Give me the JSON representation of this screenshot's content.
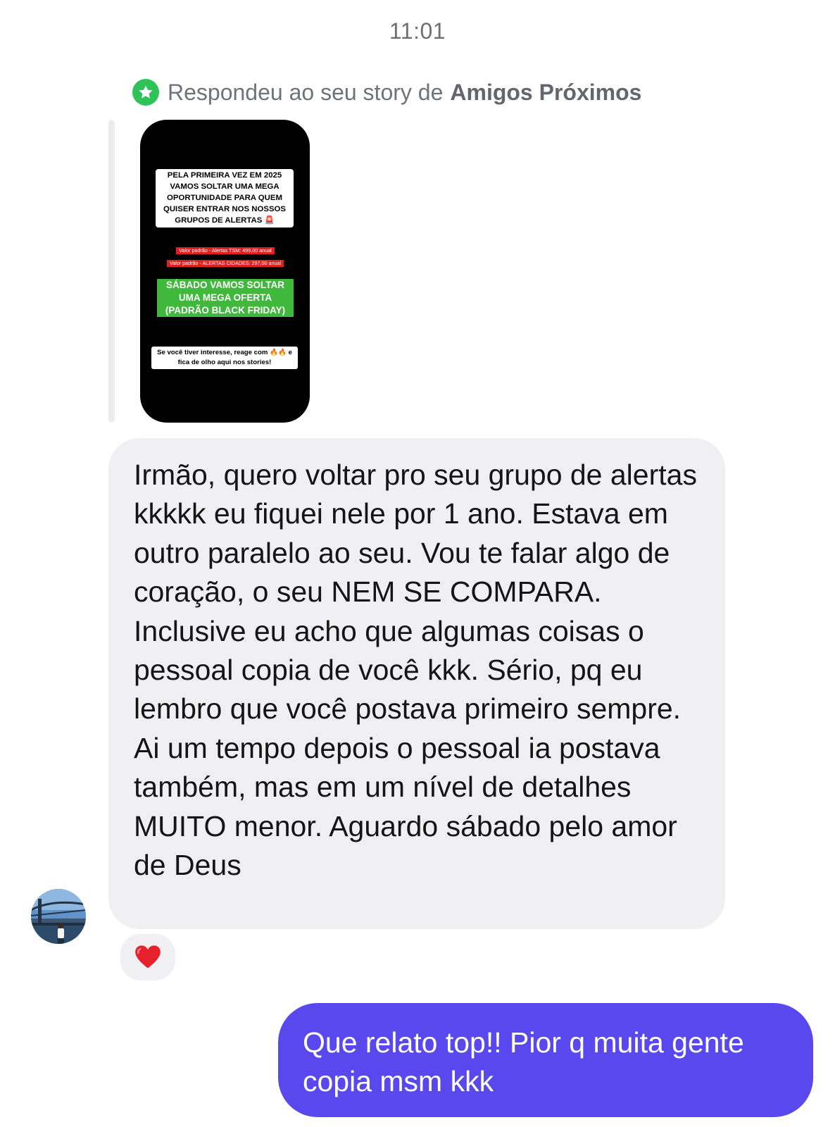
{
  "chat": {
    "timestamp": "11:01",
    "story_reply": {
      "prefix": "Respondeu ao seu story de",
      "audience": "Amigos Próximos"
    },
    "story_preview": {
      "headline": "PELA PRIMEIRA VEZ EM 2025 VAMOS SOLTAR UMA MEGA OPORTUNIDADE PARA QUEM QUISER ENTRAR NOS NOSSOS GRUPOS DE ALERTAS 🚨",
      "price_line_1": "Valor padrão - Alertas TSM: 499,00 anual",
      "price_line_2": "Valor padrão - ALERTAS CIDADES: 297,00 anual",
      "offer": "SÁBADO VAMOS SOLTAR UMA MEGA OFERTA (PADRÃO BLACK FRIDAY)",
      "call_to_action": "Se você tiver interesse, reage com 🔥🔥 e fica de olho aqui nos stories!"
    },
    "incoming_message": {
      "text": "Irmão, quero voltar pro seu grupo de alertas kkkkk eu fiquei nele por 1 ano. Estava em outro paralelo ao seu. Vou te falar algo de coração, o seu NEM SE COMPARA. Inclusive eu acho que algumas coisas o pessoal copia de você kkk. Sério, pq eu lembro que você postava primeiro sempre. Ai um tempo depois o pessoal ia postava também, mas em um nível de detalhes MUITO menor. Aguardo sábado pelo amor de Deus",
      "reaction": "heart-icon"
    },
    "outgoing_message": {
      "text": "Que relato top!! Pior q muita gente copia msm kkk"
    }
  },
  "colors": {
    "close_friends_green": "#2fc259",
    "incoming_bubble": "#f0f0f2",
    "outgoing_bubble": "#5848ee",
    "reaction_heart": "#e6212b"
  }
}
